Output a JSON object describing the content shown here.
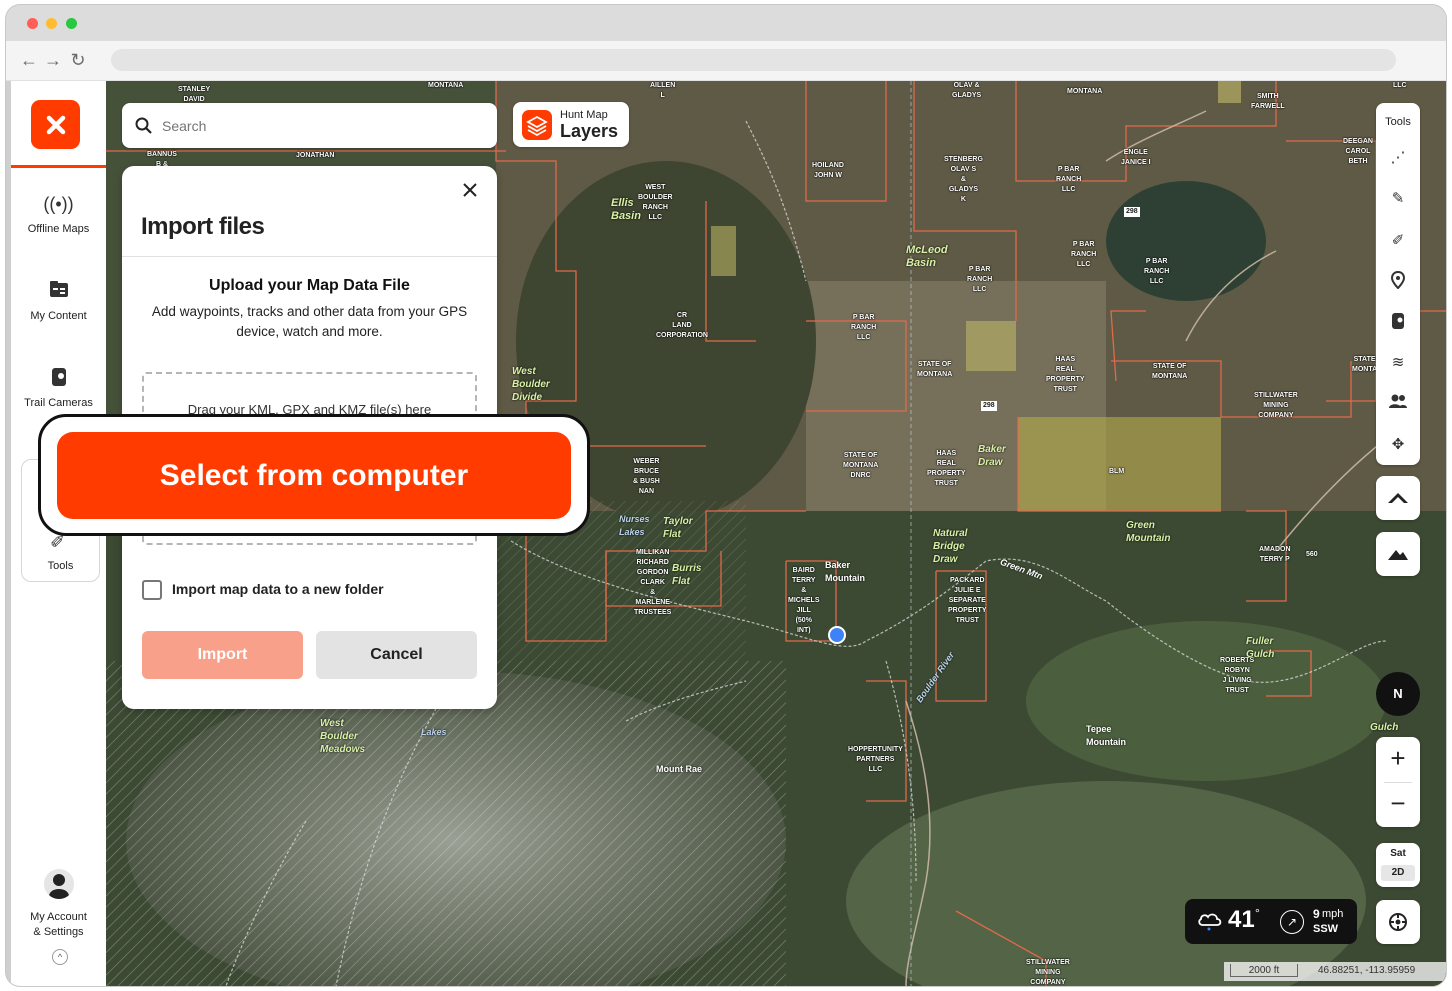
{
  "search": {
    "placeholder": "Search"
  },
  "layers_button": {
    "small": "Hunt Map",
    "big": "Layers"
  },
  "sidebar": {
    "items": [
      {
        "label": "Offline Maps",
        "icon": "offline-maps-icon"
      },
      {
        "label": "My Content",
        "icon": "my-content-icon"
      },
      {
        "label": "Trail Cameras",
        "icon": "trail-camera-icon"
      }
    ],
    "tools_label": "Tools",
    "account_label": "My Account\n& Settings"
  },
  "modal": {
    "title": "Import files",
    "upload_title": "Upload your Map Data File",
    "upload_desc": "Add waypoints, tracks and other data from your GPS device, watch and more.",
    "drop_hint": "Drag your KML, GPX and KMZ file(s) here",
    "checkbox_label": "Import map data to a new folder",
    "checkbox_checked": false,
    "import_label": "Import",
    "cancel_label": "Cancel"
  },
  "callout": {
    "label": "Select from computer"
  },
  "right_panel": {
    "tools_label": "Tools",
    "compass": "N",
    "zoom_in": "+",
    "zoom_out": "−",
    "basemap": "Sat",
    "mode": "2D"
  },
  "weather": {
    "temp": "41",
    "deg": "°",
    "wind_speed": "9",
    "wind_unit": "mph",
    "wind_dir": "SSW"
  },
  "scale": {
    "distance": "2000 ft",
    "coords": "46.88251, -113.95959"
  },
  "map_labels": [
    {
      "text": "STANLEY\nDAVID"
    },
    {
      "text": "MONTANA"
    },
    {
      "text": "AILLEN\nL"
    },
    {
      "text": "OLAV &\nGLADYS"
    },
    {
      "text": "MONTANA"
    },
    {
      "text": "SMITH\nFARWELL"
    },
    {
      "text": "LLC"
    },
    {
      "text": "BANNUS\nB &"
    },
    {
      "text": "JONATHAN"
    },
    {
      "text": "HOILAND\nJOHN W"
    },
    {
      "text": "STENBERG\nOLAV S\n&\nGLADYS\nK"
    },
    {
      "text": "P BAR\nRANCH\nLLC"
    },
    {
      "text": "ENGLE\nJANICE I"
    },
    {
      "text": "DEEGAN\nCAROL\nBETH"
    },
    {
      "text": "WEST\nBOULDER\nRANCH\nLLC"
    },
    {
      "text": "P BAR\nRANCH\nLLC"
    },
    {
      "text": "P BAR\nRANCH\nLLC"
    },
    {
      "text": "P BAR\nRANCH\nLLC"
    },
    {
      "text": "CR\nLAND\nCORPORATION"
    },
    {
      "text": "P BAR\nRANCH\nLLC"
    },
    {
      "text": "STATE OF\nMONTANA"
    },
    {
      "text": "HAAS\nREAL\nPROPERTY\nTRUST"
    },
    {
      "text": "STATE OF\nMONTANA"
    },
    {
      "text": "STATE\nMONTA"
    },
    {
      "text": "STILLWATER\nMINING\nCOMPANY"
    },
    {
      "text": "STATE OF\nMONTANA\nDNRC"
    },
    {
      "text": "HAAS\nREAL\nPROPERTY\nTRUST"
    },
    {
      "text": "BLM"
    },
    {
      "text": "WEBER\nBRUCE\n& BUSH\nNAN"
    },
    {
      "text": "AMADON\nTERRY P"
    },
    {
      "text": "560"
    },
    {
      "text": "MILLIKAN\nRICHARD\nGORDON\nCLARK\n&\nMARLENE\nTRUSTEES"
    },
    {
      "text": "BAIRD\nTERRY\n&\nMICHELS\nJILL\n(50%\nINT)"
    },
    {
      "text": "PACKARD\nJULIE E\nSEPARATE\nPROPERTY\nTRUST"
    },
    {
      "text": "ROBERTS\nROBYN\nJ LIVING\nTRUST"
    },
    {
      "text": "HOPPERTUNITY\nPARTNERS\nLLC"
    },
    {
      "text": "STILLWATER\nMINING\nCOMPANY"
    },
    {
      "text": "298"
    },
    {
      "text": "298"
    }
  ],
  "place_labels": [
    {
      "text": "Ellis\nBasin"
    },
    {
      "text": "McLeod\nBasin"
    },
    {
      "text": "West\nBoulder\nDivide"
    },
    {
      "text": "Baker\nDraw"
    },
    {
      "text": "Green\nMountain"
    },
    {
      "text": "Taylor\nFlat"
    },
    {
      "text": "Nurses\nLakes"
    },
    {
      "text": "Burris\nFlat"
    },
    {
      "text": "Baker\nMountain"
    },
    {
      "text": "Natural\nBridge\nDraw"
    },
    {
      "text": "Fuller\nGulch"
    },
    {
      "text": "Tepee\nMountain"
    },
    {
      "text": "West\nBoulder\nMeadows"
    },
    {
      "text": "Mount Rae"
    },
    {
      "text": "Lakes"
    },
    {
      "text": "Gulch"
    },
    {
      "text": "Boulder River"
    },
    {
      "text": "Green Mtn"
    }
  ]
}
